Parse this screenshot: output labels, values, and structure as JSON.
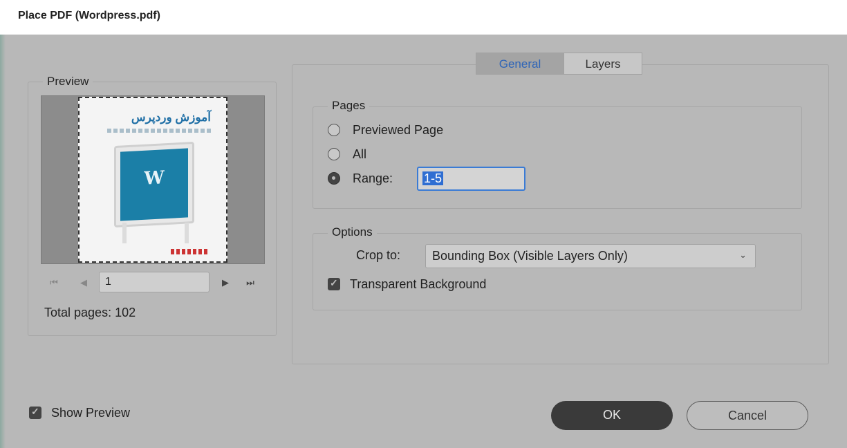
{
  "window": {
    "title": "Place PDF (Wordpress.pdf)"
  },
  "preview": {
    "legend": "Preview",
    "thumbnail_header": "آموزش وردپرس",
    "thumbnail_wp_mark": "W",
    "page_value": "1",
    "total_pages_text": "Total pages: 102",
    "nav": {
      "first": "⏮",
      "prev": "◀",
      "next": "▶",
      "last": "⏭"
    }
  },
  "tabs": [
    {
      "label": "General",
      "active": true
    },
    {
      "label": "Layers",
      "active": false
    }
  ],
  "pages": {
    "legend": "Pages",
    "options": [
      {
        "label": "Previewed Page",
        "checked": false
      },
      {
        "label": "All",
        "checked": false
      },
      {
        "label": "Range:",
        "checked": true
      }
    ],
    "range_value": "1-5"
  },
  "options": {
    "legend": "Options",
    "crop_label": "Crop to:",
    "crop_value": "Bounding Box (Visible Layers Only)",
    "transparent_background": {
      "label": "Transparent Background",
      "checked": true
    }
  },
  "show_preview": {
    "label": "Show Preview",
    "checked": true
  },
  "buttons": {
    "ok": "OK",
    "cancel": "Cancel"
  },
  "colors": {
    "accent": "#2f65b7",
    "dialog_bg": "#b8b8b8",
    "ok_bg": "#3a3a3a"
  }
}
